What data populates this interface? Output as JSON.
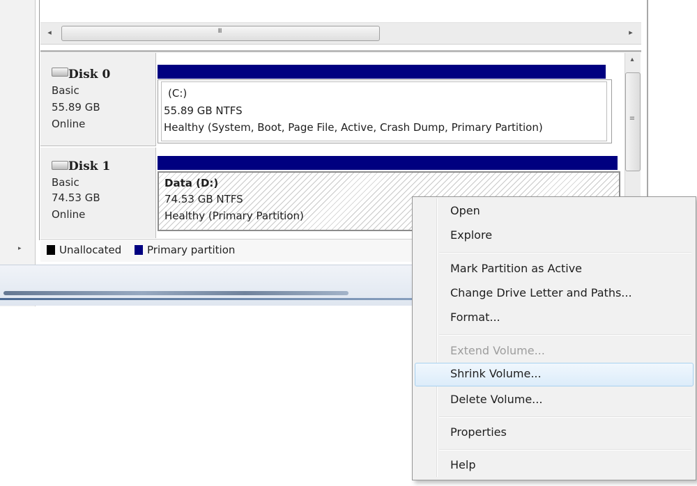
{
  "scrollbars": {
    "hscroll_left_arrow": "◂",
    "hscroll_right_arrow": "▸",
    "hscroll_grip": "III",
    "vscroll_up_arrow": "▴",
    "vscroll_grip": "≡"
  },
  "disks": [
    {
      "name": "Disk 0",
      "type": "Basic",
      "size": "55.89 GB",
      "status": "Online",
      "partition": {
        "label": "(C:)",
        "size_fs": "55.89 GB NTFS",
        "health": "Healthy (System, Boot, Page File, Active, Crash Dump, Primary Partition)"
      }
    },
    {
      "name": "Disk 1",
      "type": "Basic",
      "size": "74.53 GB",
      "status": "Online",
      "partition": {
        "label": "Data  (D:)",
        "size_fs": "74.53 GB NTFS",
        "health": "Healthy (Primary Partition)"
      }
    }
  ],
  "legend": {
    "expander": "▸",
    "items": [
      {
        "label": "Unallocated",
        "color": "#000000"
      },
      {
        "label": "Primary partition",
        "color": "#000080"
      }
    ]
  },
  "colors": {
    "primary_partition": "#000080",
    "menu_highlight_border": "#a8d1ef"
  },
  "context_menu": {
    "items": [
      {
        "label": "Open",
        "enabled": true
      },
      {
        "label": "Explore",
        "enabled": true
      },
      {
        "label": "Mark Partition as Active",
        "enabled": true
      },
      {
        "label": "Change Drive Letter and Paths...",
        "enabled": true
      },
      {
        "label": "Format...",
        "enabled": true
      },
      {
        "label": "Extend Volume...",
        "enabled": false
      },
      {
        "label": "Shrink Volume...",
        "enabled": true,
        "highlighted": true
      },
      {
        "label": "Delete Volume...",
        "enabled": true
      },
      {
        "label": "Properties",
        "enabled": true
      },
      {
        "label": "Help",
        "enabled": true
      }
    ]
  }
}
